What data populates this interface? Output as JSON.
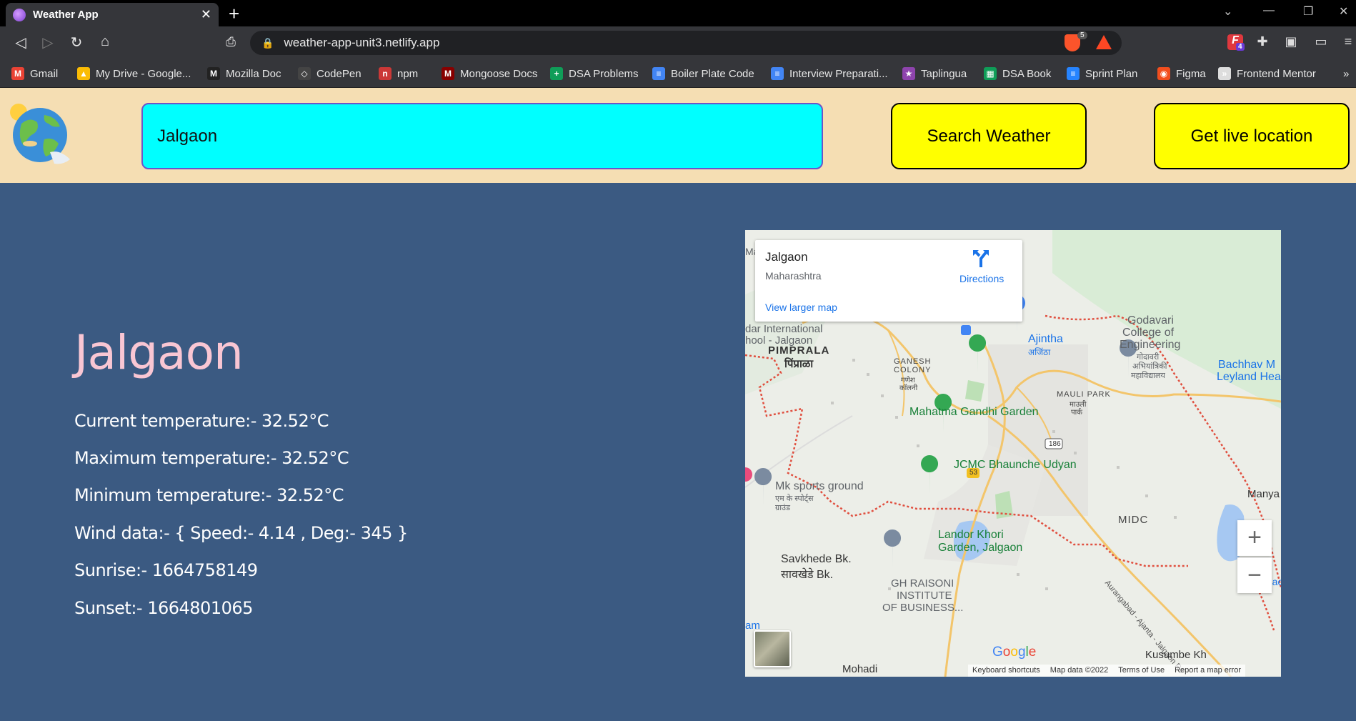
{
  "browser": {
    "tab_title": "Weather App",
    "url": "weather-app-unit3.netlify.app",
    "brave_count": "5",
    "ext_badge": "4",
    "bookmarks": [
      {
        "label": "Gmail",
        "color": "#ea4335",
        "glyph": "M"
      },
      {
        "label": "My Drive - Google...",
        "color": "#fbbc04",
        "glyph": "▲"
      },
      {
        "label": "Mozilla Doc",
        "color": "#222222",
        "glyph": "M"
      },
      {
        "label": "CodePen",
        "color": "#444444",
        "glyph": "◇"
      },
      {
        "label": "npm",
        "color": "#cb3837",
        "glyph": "n"
      },
      {
        "label": "Mongoose Docs",
        "color": "#880000",
        "glyph": "M"
      },
      {
        "label": "DSA Problems",
        "color": "#0f9d58",
        "glyph": "+"
      },
      {
        "label": "Boiler Plate Code",
        "color": "#4285f4",
        "glyph": "≡"
      },
      {
        "label": "Interview Preparati...",
        "color": "#4285f4",
        "glyph": "≡"
      },
      {
        "label": "Taplingua",
        "color": "#8e44ad",
        "glyph": "★"
      },
      {
        "label": "DSA Book",
        "color": "#0f9d58",
        "glyph": "▦"
      },
      {
        "label": "Sprint Plan",
        "color": "#2684ff",
        "glyph": "≡"
      },
      {
        "label": "Figma",
        "color": "#f24e1e",
        "glyph": "◉"
      },
      {
        "label": "Frontend Mentor",
        "color": "#dddddd",
        "glyph": "»"
      }
    ]
  },
  "header": {
    "search_value": "Jalgaon",
    "search_button": "Search Weather",
    "live_button": "Get live location"
  },
  "weather": {
    "city": "Jalgaon",
    "current_temp": "Current temperature:- 32.52°C",
    "max_temp": "Maximum temperature:- 32.52°C",
    "min_temp": "Minimum temperature:- 32.52°C",
    "wind": "Wind data:- { Speed:- 4.14 , Deg:- 345 }",
    "sunrise": "Sunrise:- 1664758149",
    "sunset": "Sunset:- 1664801065"
  },
  "map": {
    "place": "Jalgaon",
    "state": "Maharashtra",
    "directions": "Directions",
    "view_larger": "View larger map",
    "labels": {
      "pimprala": "PIMPRALA",
      "pimprala_mr": "पिंप्राळा",
      "school": "dar International",
      "school2": "hool - Jalgaon",
      "ganesh": "GANESH",
      "colony": "COLONY",
      "ganesh_mr": "गणेश",
      "colony_mr": "कॉलनी",
      "ajintha": "Ajintha",
      "ajintha_mr": "अजिंठा",
      "godavari1": "Godavari",
      "godavari2": "College of",
      "godavari3": "Engineering",
      "godavari_mr1": "गोदावरी",
      "godavari_mr2": "अभियांत्रिकी",
      "godavari_mr3": "महाविद्यालय",
      "bachhav1": "Bachhav M",
      "bachhav2": "Leyland Hea",
      "mauli": "MAULI PARK",
      "mauli_mr1": "माउली",
      "mauli_mr2": "पार्क",
      "gandhi": "Mahatma Gandhi Garden",
      "jcmc": "JCMC Bhaunche Udyan",
      "road53": "53",
      "road186": "186",
      "mk1": "Mk sports ground",
      "mk_mr1": "एम के स्पोर्ट्स",
      "mk_mr2": "ग्राउंड",
      "manya": "Manya",
      "midc": "MIDC",
      "landor1": "Landor Khori",
      "landor2": "Garden, Jalgaon",
      "savkhede": "Savkhede Bk.",
      "savkhede_mr": "सावखेडे Bk.",
      "raisoni1": "GH RAISONI",
      "raisoni2": "INSTITUTE",
      "raisoni3": "OF BUSINESS...",
      "road_name": "Aurangabad - Ajanta - Jalgaon Rd",
      "kusumbe": "Kusumbe Kh",
      "mohadi": "Mohadi",
      "am": "am",
      "jalgaon_edge": "Jalgaon",
      "ma": "Ma"
    },
    "google": "Google",
    "attrib": [
      "Keyboard shortcuts",
      "Map data ©2022",
      "Terms of Use",
      "Report a map error"
    ]
  }
}
